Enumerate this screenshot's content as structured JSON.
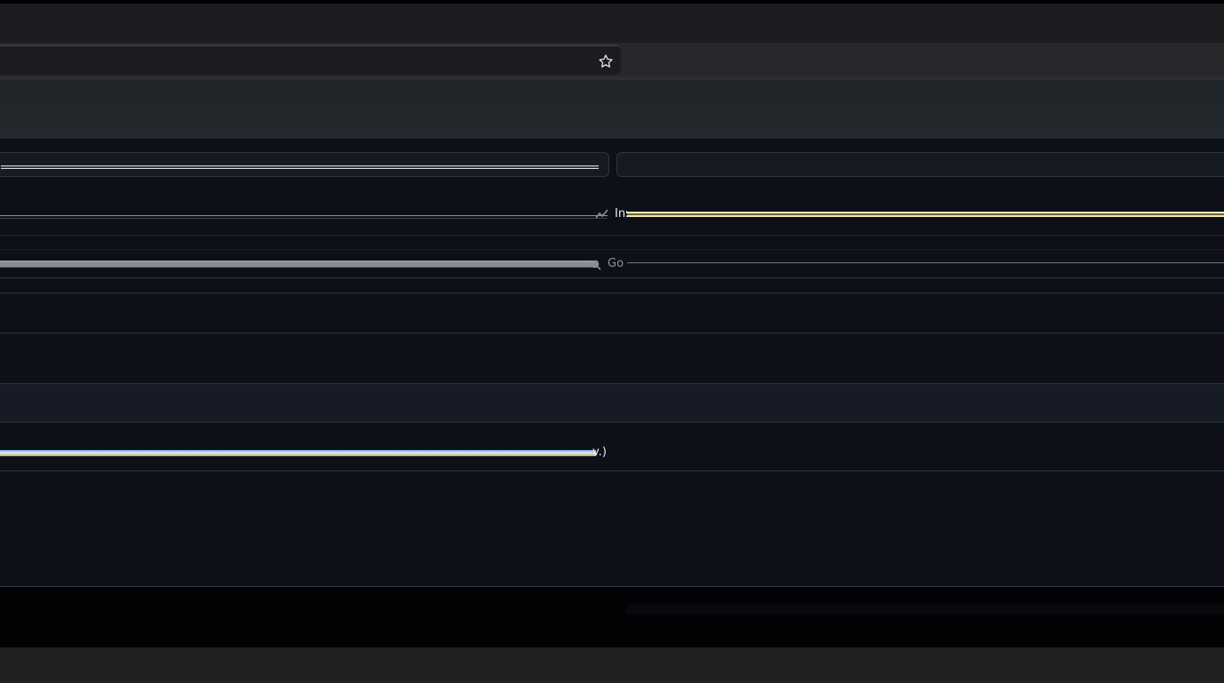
{
  "browser": {
    "title_text": "· · · · ·",
    "address_text": "·· · ··· ·· · ·· ··· ···",
    "star_icon": "star-outline-icon"
  },
  "buttons": {
    "right_faint_text": "· · ·"
  },
  "rows": [
    {
      "label": "Ins",
      "icon": "trend-icon"
    },
    {
      "label": "Go",
      "icon": "search-icon"
    },
    {
      "label": "v.)"
    }
  ],
  "colors": {
    "background": "#0d1117",
    "title_bar": "#1c1b20",
    "toolbar": "#28272c",
    "banner": "#24292e",
    "border": "#30363d",
    "accent_yellow": "#f3e6b0",
    "taskbar": "#202020"
  }
}
